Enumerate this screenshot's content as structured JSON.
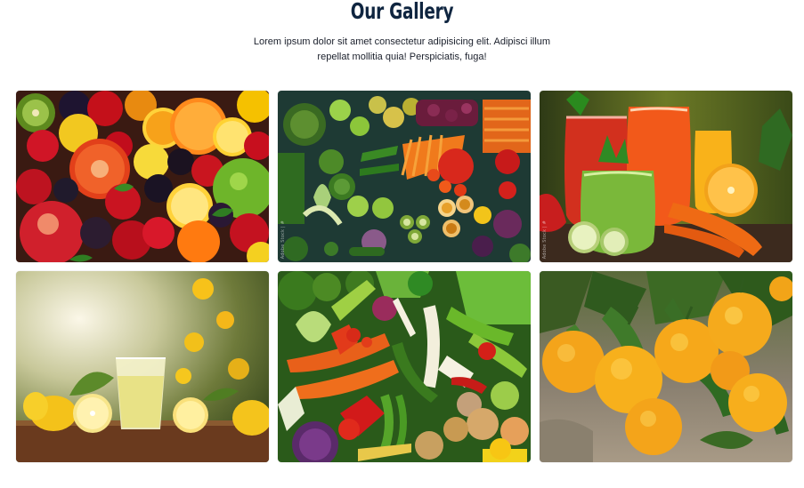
{
  "section": {
    "title": "Our Gallery",
    "subtitle": "Lorem ipsum dolor sit amet consectetur adipisicing elit. Adipisci illum repellat mollitia quia! Perspiciatis, fuga!"
  },
  "gallery": {
    "images": [
      {
        "subject": "assorted-fruits"
      },
      {
        "subject": "assorted-vegetables-flatlay",
        "watermark": "Adobe Stock | #"
      },
      {
        "subject": "fresh-juices-and-smoothies",
        "watermark": "Adobe Stock | #"
      },
      {
        "subject": "lemonade-with-lemons"
      },
      {
        "subject": "mixed-vegetables"
      },
      {
        "subject": "oranges-on-tree"
      }
    ]
  },
  "colors": {
    "heading": "#0f2540",
    "text": "#1a1f2b",
    "background": "#ffffff"
  }
}
